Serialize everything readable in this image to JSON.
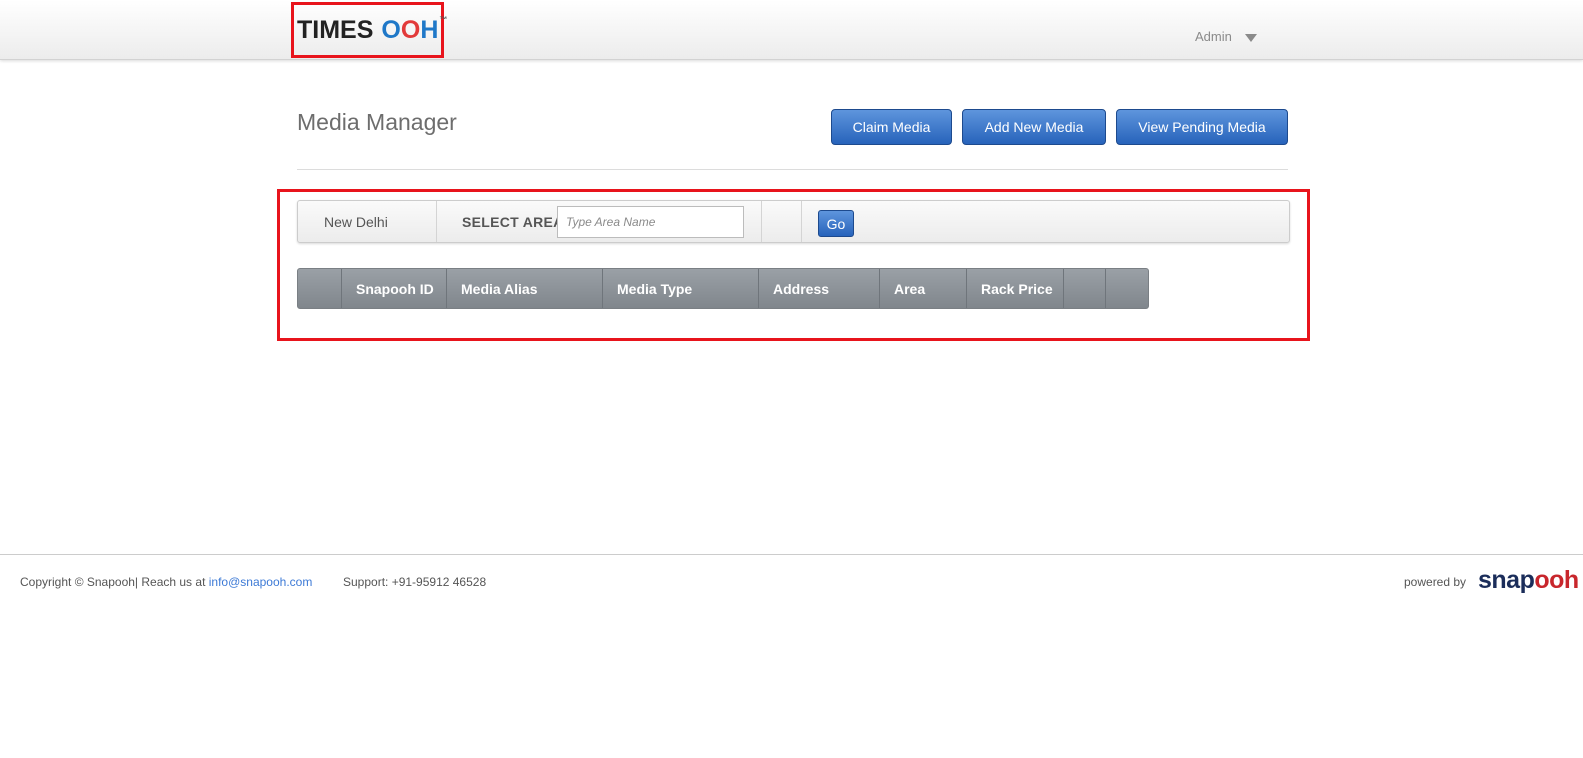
{
  "header": {
    "logo_times": "TIMES",
    "logo_ooh_first": "O",
    "logo_ooh_second": "O",
    "logo_ooh_h": "H",
    "logo_tm": "™",
    "user_label": "Admin"
  },
  "page": {
    "title": "Media Manager",
    "buttons": {
      "claim": "Claim Media",
      "add": "Add New Media",
      "pending": "View Pending Media"
    }
  },
  "filter": {
    "city": "New Delhi",
    "area_label": "SELECT AREA",
    "area_placeholder": "Type Area Name",
    "area_value": "",
    "go_label": "Go"
  },
  "table": {
    "columns": [
      {
        "label": ""
      },
      {
        "label": "Snapooh ID"
      },
      {
        "label": "Media Alias"
      },
      {
        "label": "Media Type"
      },
      {
        "label": "Address"
      },
      {
        "label": "Area"
      },
      {
        "label": "Rack Price"
      },
      {
        "label": ""
      },
      {
        "label": ""
      }
    ],
    "rows": []
  },
  "footer": {
    "copyright": "Copyright © Snapooh| Reach us at ",
    "email": "info@snapooh.com",
    "support": "Support: +91-95912 46528",
    "powered_by": "powered by",
    "brand_part1": "snap",
    "brand_part2": "ooh"
  },
  "colors": {
    "highlight": "#e8141c",
    "button_blue": "#2763bb",
    "table_header": "#8b9197",
    "link": "#3d7ad6",
    "brand_navy": "#1b2d5a",
    "brand_red": "#c8262c"
  }
}
